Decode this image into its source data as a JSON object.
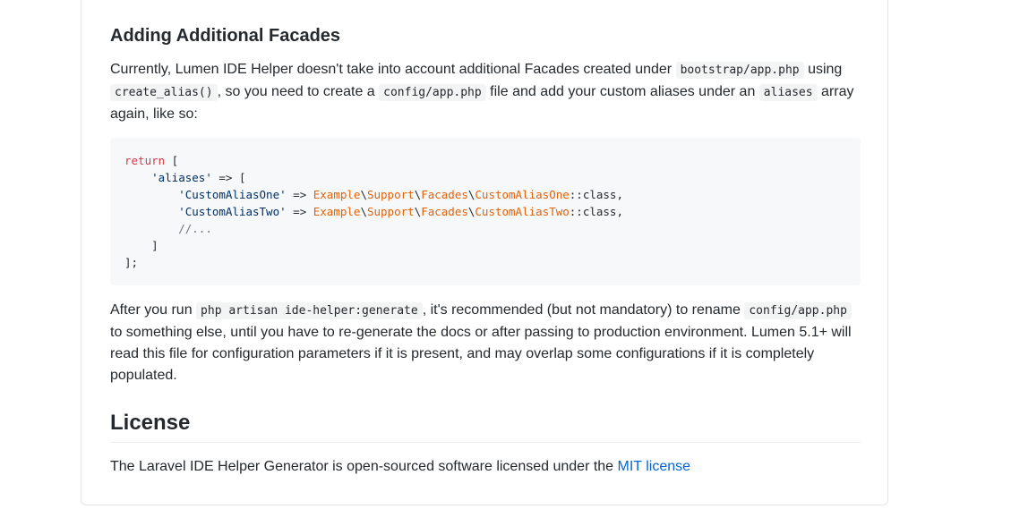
{
  "section": {
    "heading": "Adding Additional Facades",
    "p1": {
      "t1": "Currently, Lumen IDE Helper doesn't take into account additional Facades created under ",
      "c1": "bootstrap/app.php",
      "t2": " using ",
      "c2": "create_alias()",
      "t3": ", so you need to create a ",
      "c3": "config/app.php",
      "t4": " file and add your custom aliases under an ",
      "c4": "aliases",
      "t5": " array again, like so:"
    },
    "code": {
      "l1_kw": "return",
      "l1_rest": " [",
      "l2_str": "'aliases'",
      "l2_rest": " => [",
      "l3_str": "'CustomAliasOne'",
      "l3_arrow": " => ",
      "l3_c1": "Example",
      "l3_c2": "Support",
      "l3_c3": "Facades",
      "l3_c4": "CustomAliasOne",
      "l3_tail": "::class,",
      "l4_str": "'CustomAliasTwo'",
      "l4_arrow": " => ",
      "l4_c1": "Example",
      "l4_c2": "Support",
      "l4_c3": "Facades",
      "l4_c4": "CustomAliasTwo",
      "l4_tail": "::class,",
      "l5": "//...",
      "l6": "]",
      "l7": "];",
      "sep": "\\"
    },
    "p2": {
      "t1": "After you run ",
      "c1": "php artisan ide-helper:generate",
      "t2": ", it's recommended (but not mandatory) to rename ",
      "c2": "config/app.php",
      "t3": " to something else, until you have to re-generate the docs or after passing to production environment. Lumen 5.1+ will read this file for configuration parameters if it is present, and may overlap some configurations if it is completely populated."
    }
  },
  "license": {
    "heading": "License",
    "text": "The Laravel IDE Helper Generator is open-sourced software licensed under the ",
    "link": "MIT license"
  }
}
